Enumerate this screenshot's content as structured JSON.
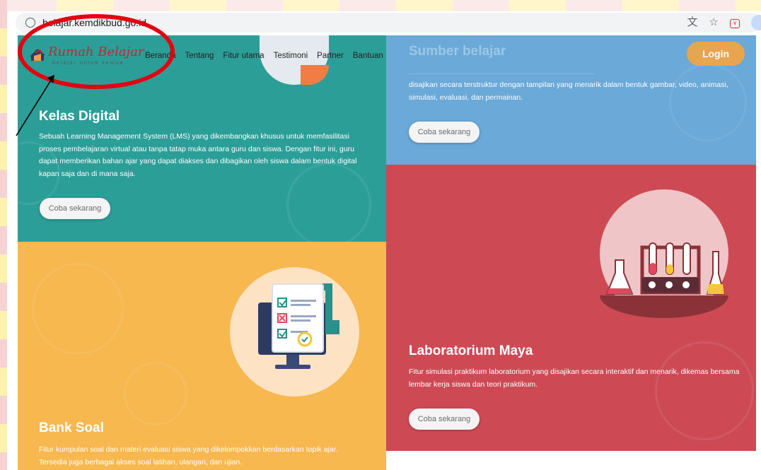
{
  "browser": {
    "url": "belajar.kemdikbud.go.id",
    "icons": [
      "translate-icon",
      "star-icon",
      "pocket-icon",
      "profile-icon"
    ]
  },
  "header": {
    "logo_title": "Rumah Belajar",
    "logo_tagline": "belajar untuk semua",
    "nav": [
      "Beranda",
      "Tentang",
      "Fitur utama",
      "Testimoni",
      "Partner",
      "Bantuan"
    ],
    "login_label": "Login"
  },
  "cards": {
    "kelas_digital": {
      "title": "Kelas Digital",
      "desc": "Sebuah Learning Management System (LMS) yang dikembangkan khusus untuk memfasilitasi proses pembelajaran virtual atau tanpa tatap muka antara guru dan siswa. Dengan fitur ini, guru dapat memberikan bahan ajar yang dapat diakses dan dibagikan oleh siswa dalam bentuk digital kapan saja dan di mana saja.",
      "cta": "Coba sekarang"
    },
    "sumber_belajar": {
      "title": "Sumber belajar",
      "desc": "disajikan secara terstruktur dengan tampilan yang menarik dalam bentuk gambar, video, animasi, simulasi, evaluasi, dan permainan.",
      "cta": "Coba sekarang"
    },
    "laboratorium_maya": {
      "title": "Laboratorium Maya",
      "desc": "Fitur simulasi praktikum laboratorium yang disajikan secara interaktif dan menarik, dikemas bersama lembar kerja siswa dan teori praktikum.",
      "cta": "Coba sekarang"
    },
    "bank_soal": {
      "title": "Bank Soal",
      "desc": "Fitur kumpulan soal dan materi evaluasi siswa yang dikelompokkan berdasarkan topik ajar. Tersedia juga berbagai akses soal latihan, ulangan, dan ujian."
    }
  },
  "colors": {
    "teal": "#2c9e98",
    "blue": "#6aa9d8",
    "red": "#cd4a55",
    "yellow": "#f7b850",
    "login": "#e8a550",
    "annotation": "#e30010"
  }
}
